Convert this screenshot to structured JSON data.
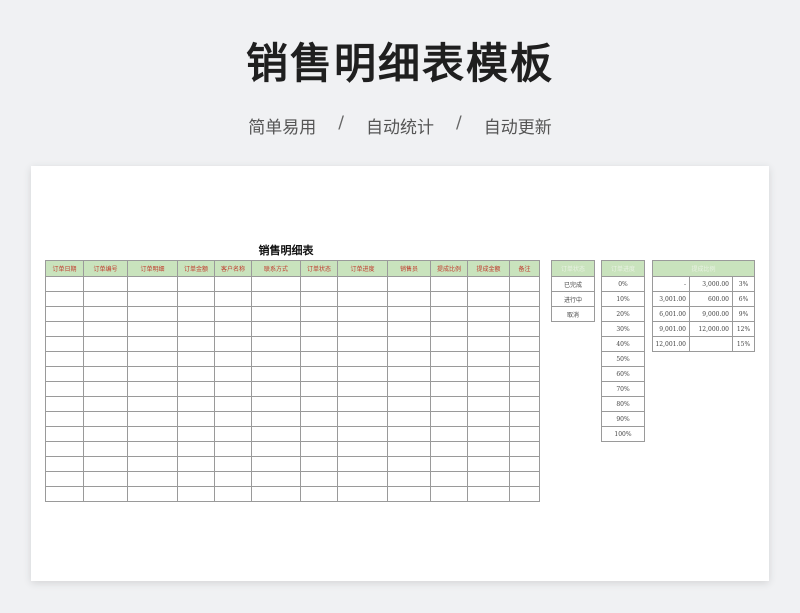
{
  "page": {
    "title": "销售明细表模板",
    "subtitle": [
      "简单易用",
      "自动统计",
      "自动更新"
    ],
    "separator": "/"
  },
  "sheet": {
    "title": "销售明细表",
    "headers": [
      "订单日期",
      "订单编号",
      "订单明细",
      "订单金额",
      "客户名称",
      "联系方式",
      "订单状态",
      "订单进度",
      "销售员",
      "提成比例",
      "提成金额",
      "备注"
    ],
    "empty_rows": 15
  },
  "status_table": {
    "header": "订单状态",
    "items": [
      "已完成",
      "进行中",
      "取消"
    ]
  },
  "progress_table": {
    "header": "订单进度",
    "items": [
      "0%",
      "10%",
      "20%",
      "30%",
      "40%",
      "50%",
      "60%",
      "70%",
      "80%",
      "90%",
      "100%"
    ]
  },
  "commission_table": {
    "header": "提成比例",
    "rows": [
      [
        "-",
        "3,000.00",
        "3%"
      ],
      [
        "3,001.00",
        "600.00",
        "6%"
      ],
      [
        "6,001.00",
        "9,000.00",
        "9%"
      ],
      [
        "9,001.00",
        "12,000.00",
        "12%"
      ],
      [
        "12,001.00",
        "",
        "15%"
      ]
    ]
  }
}
